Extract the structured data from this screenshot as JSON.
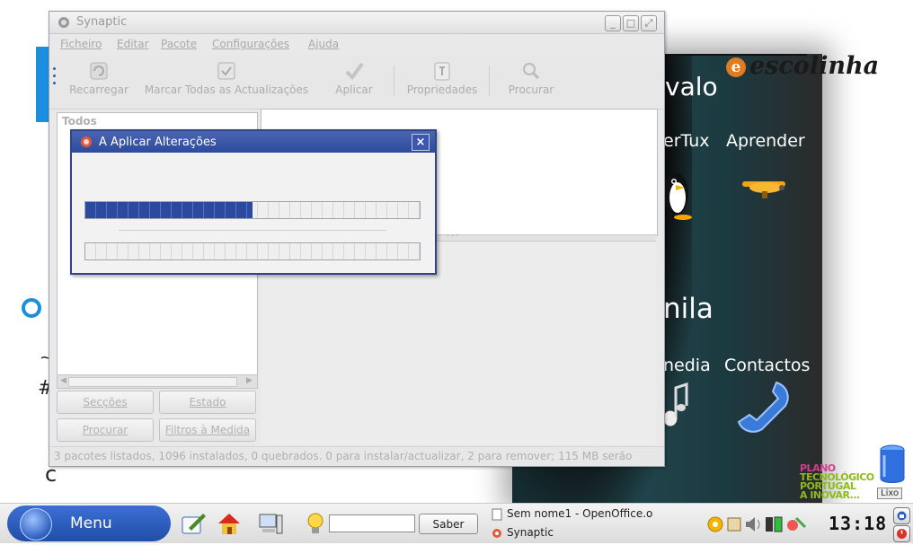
{
  "desktop": {
    "escolinha_logo": "escolinha",
    "launchers": [
      "valo",
      "erTux",
      "Aprender",
      "nila",
      "nedia",
      "Contactos"
    ],
    "plano_lines": [
      "PLANO",
      "TECNOLÓGICO",
      "PORTUGAL",
      "A INOVAR..."
    ],
    "trash_label": "Lixo",
    "left_glyphs": [
      "~",
      "#",
      "c"
    ]
  },
  "synaptic": {
    "title": "Synaptic",
    "menu": [
      "Ficheiro",
      "Editar",
      "Pacote",
      "Configurações",
      "Ajuda"
    ],
    "toolbar": [
      "Recarregar",
      "Marcar Todas as Actualizações",
      "Aplicar",
      "Propriedades",
      "Procurar"
    ],
    "left_header": "Todos",
    "side_buttons": [
      "Secções",
      "Estado",
      "Procurar",
      "Filtros à Medida"
    ],
    "status": "3 pacotes listados, 1096 instalados, 0 quebrados. 0 para instalar/actualizar, 2 para remover; 115 MB serão"
  },
  "dialog": {
    "title": "A Aplicar Alterações",
    "close": "×",
    "progress_main": 0.5,
    "progress_sub": 0
  },
  "taskbar": {
    "menu_label": "Menu",
    "search_placeholder": "",
    "search_button": "Saber",
    "tasks": [
      "Sem nome1 - OpenOffice.o",
      "Synaptic"
    ],
    "clock": "13:18"
  },
  "colors": {
    "accent": "#2d4a9c",
    "progress_fill": "#2b4a9f",
    "menu_button": "#1f4ea8",
    "desktop_blue": "#1a8fe0"
  }
}
